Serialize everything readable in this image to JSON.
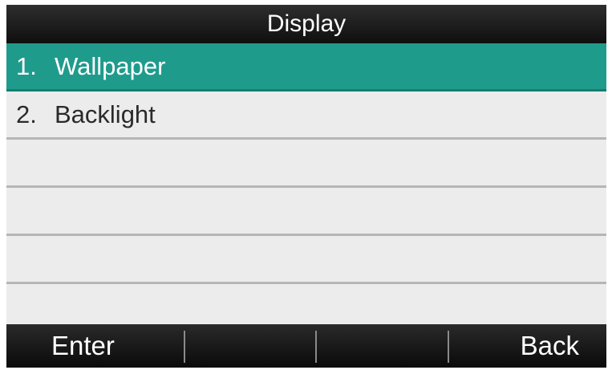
{
  "screen": {
    "title": "Display"
  },
  "menu": {
    "items": [
      {
        "number": "1.",
        "label": "Wallpaper",
        "selected": true
      },
      {
        "number": "2.",
        "label": "Backlight",
        "selected": false
      },
      {
        "number": "",
        "label": "",
        "selected": false
      },
      {
        "number": "",
        "label": "",
        "selected": false
      },
      {
        "number": "",
        "label": "",
        "selected": false
      },
      {
        "number": "",
        "label": "",
        "selected": false
      }
    ]
  },
  "softkeys": {
    "key1": "Enter",
    "key2": "",
    "key3": "",
    "key4": "Back"
  },
  "colors": {
    "selected_row": "#1f9b8c",
    "row_background": "#ececec",
    "bar_background": "#111111"
  }
}
